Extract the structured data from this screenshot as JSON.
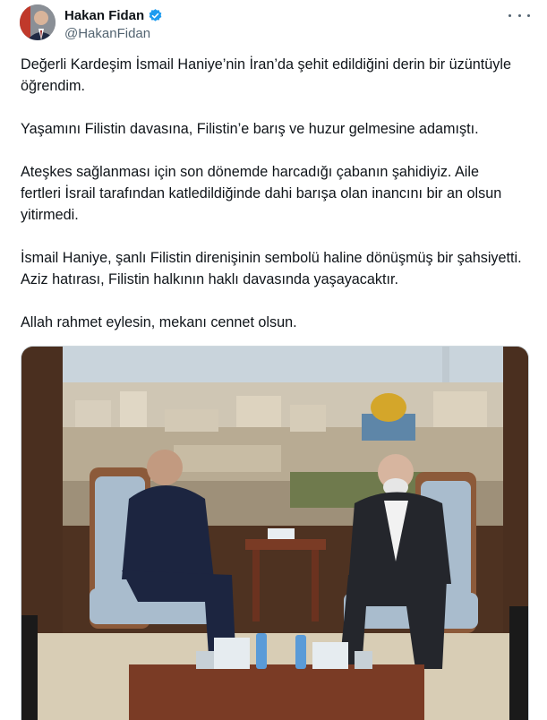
{
  "author": {
    "display_name": "Hakan Fidan",
    "handle": "@HakanFidan",
    "verified_icon": "verified-badge-icon",
    "more_icon": "more-options-icon"
  },
  "tweet": {
    "paragraphs": [
      "Değerli Kardeşim İsmail Haniye’nin İran’da şehit edildiğini derin bir üzüntüyle öğrendim.",
      "Yaşamını Filistin davasına, Filistin’e barış ve huzur gelmesine adamıştı.",
      "Ateşkes sağlanması için son dönemde harcadığı çabanın şahidiyiz. Aile fertleri İsrail tarafından katledildiğinde dahi barışa olan inancını bir an olsun yitirmedi.",
      "İsmail Haniye, şanlı Filistin direnişinin sembolü haline dönüşmüş bir şahsiyetti. Aziz hatırası, Filistin halkının haklı davasında yaşayacaktır.",
      "Allah rahmet eylesin, mekanı cennet olsun."
    ]
  },
  "colors": {
    "verified_blue": "#1d9bf0",
    "text": "#0f1419",
    "secondary_text": "#536471",
    "border": "#cfd9de"
  }
}
